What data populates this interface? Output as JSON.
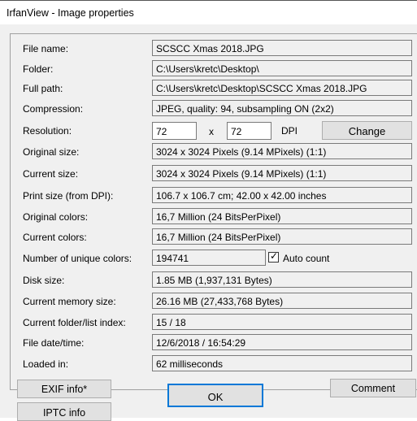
{
  "window": {
    "title": "IrfanView - Image properties"
  },
  "fields": [
    {
      "label": "File name:",
      "value": "SCSCC Xmas 2018.JPG"
    },
    {
      "label": "Folder:",
      "value": "C:\\Users\\kretc\\Desktop\\"
    },
    {
      "label": "Full path:",
      "value": "C:\\Users\\kretc\\Desktop\\SCSCC Xmas 2018.JPG"
    },
    {
      "label": "Compression:",
      "value": "JPEG, quality: 94, subsampling ON (2x2)"
    },
    {
      "label": "Resolution:"
    },
    {
      "label": "Original size:",
      "value": "3024 x 3024  Pixels (9.14 MPixels) (1:1)"
    },
    {
      "label": "Current size:",
      "value": "3024 x 3024  Pixels (9.14 MPixels) (1:1)"
    },
    {
      "label": "Print size (from DPI):",
      "value": "106.7 x 106.7 cm; 42.00 x 42.00 inches"
    },
    {
      "label": "Original colors:",
      "value": "16,7 Million  (24 BitsPerPixel)"
    },
    {
      "label": "Current colors:",
      "value": "16,7 Million  (24 BitsPerPixel)"
    },
    {
      "label": "Number of unique colors:",
      "value": "194741"
    },
    {
      "label": "Disk size:",
      "value": "1.85 MB (1,937,131 Bytes)"
    },
    {
      "label": "Current memory size:",
      "value": "26.16  MB (27,433,768 Bytes)"
    },
    {
      "label": "Current folder/list index:",
      "value": "15  /  18"
    },
    {
      "label": "File date/time:",
      "value": "12/6/2018 / 16:54:29"
    },
    {
      "label": "Loaded in:",
      "value": "62 milliseconds"
    }
  ],
  "resolution": {
    "x": "72",
    "sep": "x",
    "y": "72",
    "unit": "DPI",
    "change_label": "Change"
  },
  "auto_count": {
    "label": "Auto count",
    "checked": true
  },
  "buttons": {
    "exif": "EXIF info*",
    "ok": "OK",
    "comment": "Comment",
    "iptc": "IPTC info"
  }
}
